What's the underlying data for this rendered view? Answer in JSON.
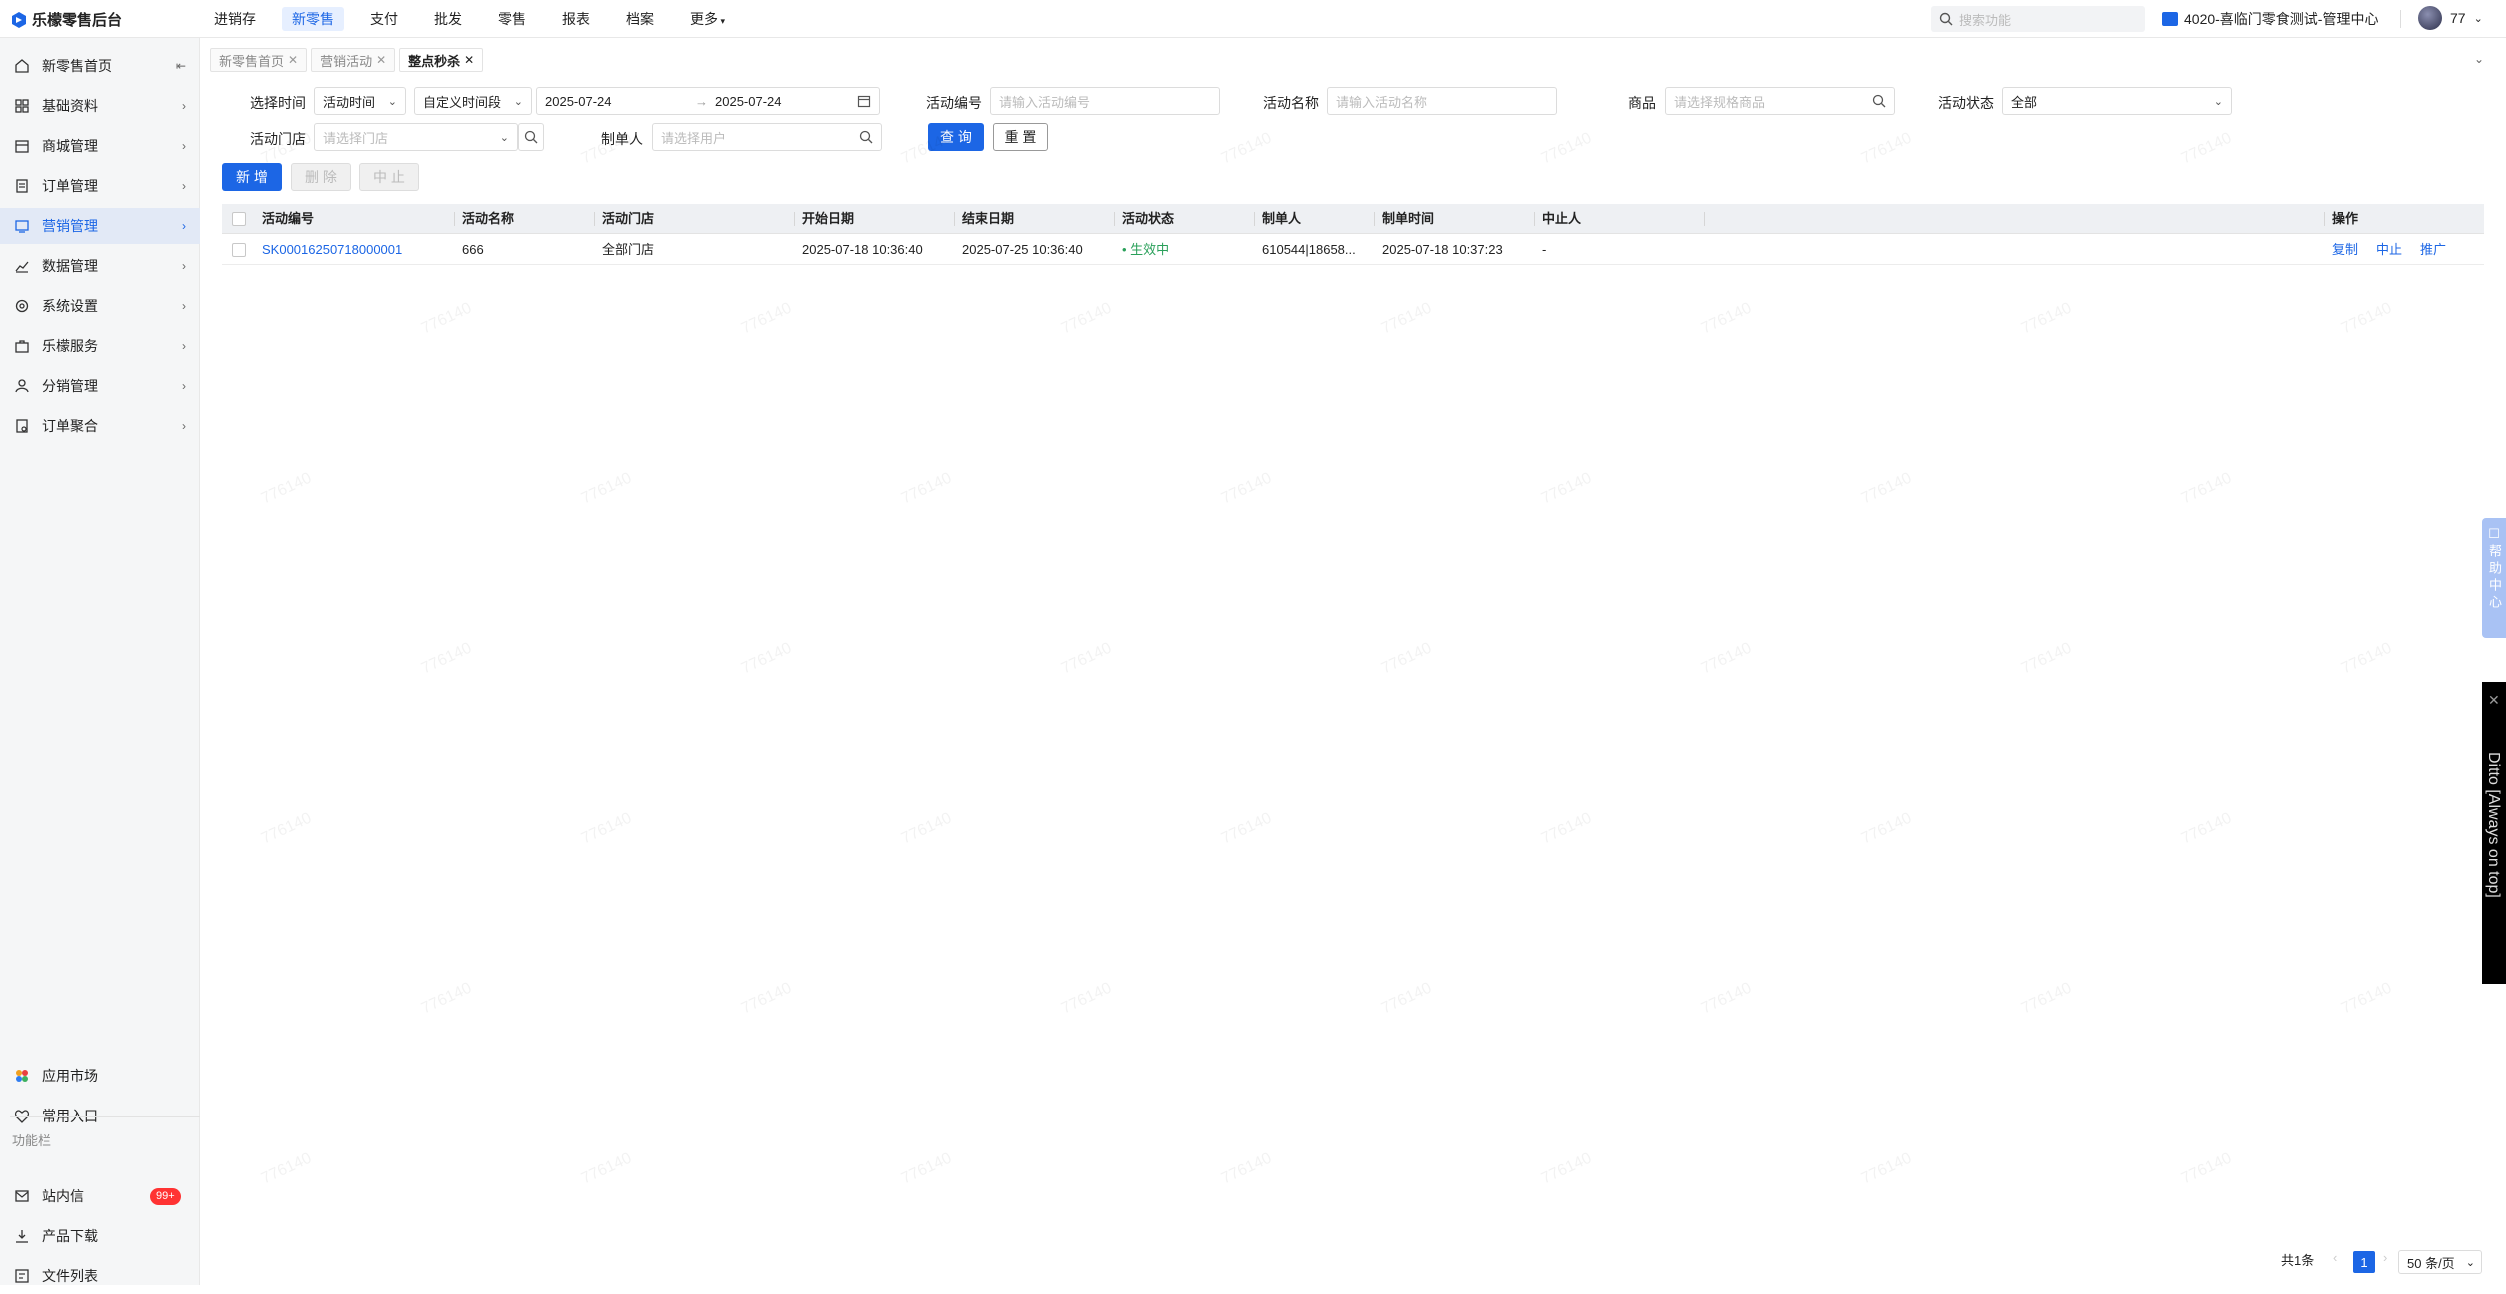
{
  "app": {
    "title": "乐檬零售后台"
  },
  "topnav": {
    "items": [
      "进销存",
      "新零售",
      "支付",
      "批发",
      "零售",
      "报表",
      "档案",
      "更多"
    ],
    "active_index": 1
  },
  "top_search": {
    "placeholder": "搜索功能"
  },
  "org": {
    "name": "4020-喜临门零食测试-管理中心"
  },
  "user": {
    "name": "77"
  },
  "sidebar": {
    "items": [
      {
        "label": "新零售首页",
        "icon": "home-icon"
      },
      {
        "label": "基础资料",
        "icon": "grid-icon"
      },
      {
        "label": "商城管理",
        "icon": "store-icon"
      },
      {
        "label": "订单管理",
        "icon": "order-icon"
      },
      {
        "label": "营销管理",
        "icon": "marketing-icon",
        "active": true
      },
      {
        "label": "数据管理",
        "icon": "chart-icon"
      },
      {
        "label": "系统设置",
        "icon": "settings-icon"
      },
      {
        "label": "乐檬服务",
        "icon": "service-icon"
      },
      {
        "label": "分销管理",
        "icon": "distribution-icon"
      },
      {
        "label": "订单聚合",
        "icon": "aggregate-icon"
      }
    ],
    "bottom": [
      {
        "label": "应用市场",
        "icon": "app-market-icon"
      },
      {
        "label": "常用入口",
        "icon": "heart-icon"
      }
    ],
    "function_bar_label": "功能栏",
    "function_items": [
      {
        "label": "站内信",
        "icon": "mail-icon",
        "badge": "99+"
      },
      {
        "label": "产品下载",
        "icon": "download-icon"
      },
      {
        "label": "文件列表",
        "icon": "file-list-icon"
      }
    ]
  },
  "tabs": [
    {
      "label": "新零售首页"
    },
    {
      "label": "营销活动"
    },
    {
      "label": "整点秒杀",
      "active": true
    }
  ],
  "filters": {
    "select_time_label": "选择时间",
    "time_type": "活动时间",
    "range_type": "自定义时间段",
    "date_start": "2025-07-24",
    "date_arrow": "→",
    "date_end": "2025-07-24",
    "activity_no_label": "活动编号",
    "activity_no_placeholder": "请输入活动编号",
    "activity_name_label": "活动名称",
    "activity_name_placeholder": "请输入活动名称",
    "product_label": "商品",
    "product_placeholder": "请选择规格商品",
    "status_label": "活动状态",
    "status_value": "全部",
    "store_label": "活动门店",
    "store_placeholder": "请选择门店",
    "maker_label": "制单人",
    "maker_placeholder": "请选择用户",
    "query_button": "查 询",
    "reset_button": "重 置"
  },
  "actions": {
    "add": "新 增",
    "delete": "删 除",
    "stop": "中 止"
  },
  "table": {
    "headers": [
      "活动编号",
      "活动名称",
      "活动门店",
      "开始日期",
      "结束日期",
      "活动状态",
      "制单人",
      "制单时间",
      "中止人",
      "操作"
    ],
    "rows": [
      {
        "no": "SK00016250718000001",
        "name": "666",
        "store": "全部门店",
        "start": "2025-07-18 10:36:40",
        "end": "2025-07-25 10:36:40",
        "status": "生效中",
        "maker": "610544|18658...",
        "made_at": "2025-07-18 10:37:23",
        "stopper": "-",
        "ops": [
          "复制",
          "中止",
          "推广"
        ]
      }
    ]
  },
  "pagination": {
    "total": "共1条",
    "page": "1",
    "page_size": "50 条/页"
  },
  "help": {
    "label": "帮助中心"
  },
  "ditto": {
    "label": "Ditto [Always on top]"
  },
  "watermark": "776140",
  "colors": {
    "primary": "#1c66e5",
    "status_active": "#2aa05a",
    "badge": "#ff3333"
  }
}
